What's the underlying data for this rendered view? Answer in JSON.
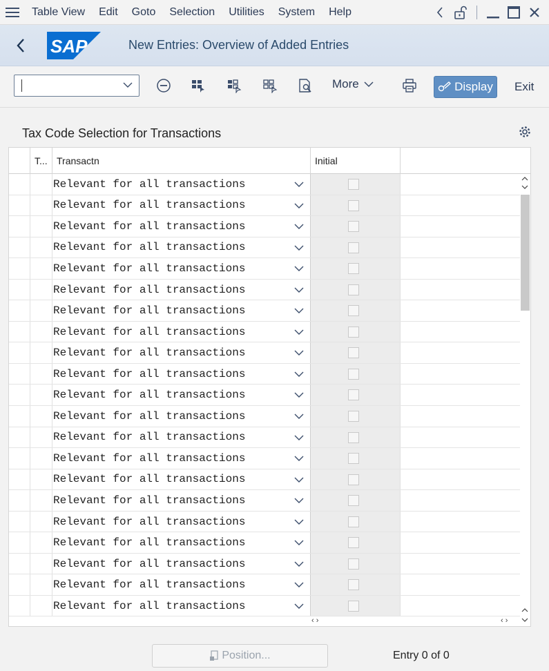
{
  "menubar": {
    "items": [
      {
        "label": "Table View"
      },
      {
        "label": "Edit"
      },
      {
        "label": "Goto"
      },
      {
        "label": "Selection"
      },
      {
        "label": "Utilities"
      },
      {
        "label": "System"
      },
      {
        "label": "Help"
      }
    ]
  },
  "titlebar": {
    "logo_text": "SAP",
    "title": "New Entries: Overview of Added Entries"
  },
  "toolbar": {
    "command_value": "",
    "more_label": "More",
    "display_label": "Display",
    "exit_label": "Exit"
  },
  "section": {
    "title": "Tax Code Selection for Transactions"
  },
  "table": {
    "columns": [
      "T...",
      "Transactn",
      "Initial"
    ],
    "rows": [
      {
        "transaction": "Relevant for all transactions",
        "initial": false
      },
      {
        "transaction": "Relevant for all transactions",
        "initial": false
      },
      {
        "transaction": "Relevant for all transactions",
        "initial": false
      },
      {
        "transaction": "Relevant for all transactions",
        "initial": false
      },
      {
        "transaction": "Relevant for all transactions",
        "initial": false
      },
      {
        "transaction": "Relevant for all transactions",
        "initial": false
      },
      {
        "transaction": "Relevant for all transactions",
        "initial": false
      },
      {
        "transaction": "Relevant for all transactions",
        "initial": false
      },
      {
        "transaction": "Relevant for all transactions",
        "initial": false
      },
      {
        "transaction": "Relevant for all transactions",
        "initial": false
      },
      {
        "transaction": "Relevant for all transactions",
        "initial": false
      },
      {
        "transaction": "Relevant for all transactions",
        "initial": false
      },
      {
        "transaction": "Relevant for all transactions",
        "initial": false
      },
      {
        "transaction": "Relevant for all transactions",
        "initial": false
      },
      {
        "transaction": "Relevant for all transactions",
        "initial": false
      },
      {
        "transaction": "Relevant for all transactions",
        "initial": false
      },
      {
        "transaction": "Relevant for all transactions",
        "initial": false
      },
      {
        "transaction": "Relevant for all transactions",
        "initial": false
      },
      {
        "transaction": "Relevant for all transactions",
        "initial": false
      },
      {
        "transaction": "Relevant for all transactions",
        "initial": false
      },
      {
        "transaction": "Relevant for all transactions",
        "initial": false
      }
    ],
    "hscroll_left": "‹ ›",
    "hscroll_right": "‹ ›"
  },
  "footer": {
    "position_label": "Position...",
    "entry_count": "Entry 0 of 0"
  },
  "colors": {
    "accent": "#5f8fc4",
    "sap_blue": "#0a6ed1",
    "title_text": "#2a4a6b"
  }
}
